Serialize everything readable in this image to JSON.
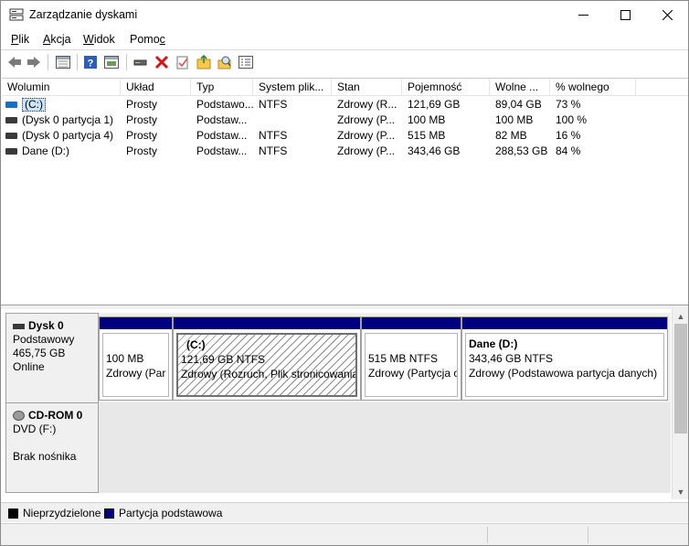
{
  "window": {
    "title": "Zarządzanie dyskami"
  },
  "menu": [
    {
      "pre": "",
      "ul": "P",
      "post": "lik"
    },
    {
      "pre": "",
      "ul": "A",
      "post": "kcja"
    },
    {
      "pre": "",
      "ul": "W",
      "post": "idok"
    },
    {
      "pre": "Pomo",
      "ul": "c",
      "post": ""
    }
  ],
  "toolbar": {
    "icons": [
      "back-arrow-icon",
      "forward-arrow-icon",
      "properties-grid-icon",
      "help-icon",
      "show-hide-pane-icon",
      "connect-drive-icon",
      "delete-icon",
      "checklist-icon",
      "new-folder-icon",
      "search-icon",
      "properties-list-icon"
    ]
  },
  "columns": [
    "Wolumin",
    "Układ",
    "Typ",
    "System plik...",
    "Stan",
    "Pojemność",
    "Wolne ...",
    "% wolnego"
  ],
  "volumes": [
    {
      "name": "(C:)",
      "layout": "Prosty",
      "type": "Podstawo...",
      "fs": "NTFS",
      "status": "Zdrowy (R...",
      "capacity": "121,69 GB",
      "free": "89,04 GB",
      "pct": "73 %"
    },
    {
      "name": "(Dysk 0 partycja 1)",
      "layout": "Prosty",
      "type": "Podstaw...",
      "fs": "",
      "status": "Zdrowy (P...",
      "capacity": "100 MB",
      "free": "100 MB",
      "pct": "100 %"
    },
    {
      "name": "(Dysk 0 partycja 4)",
      "layout": "Prosty",
      "type": "Podstaw...",
      "fs": "NTFS",
      "status": "Zdrowy (P...",
      "capacity": "515 MB",
      "free": "82 MB",
      "pct": "16 %"
    },
    {
      "name": "Dane (D:)",
      "layout": "Prosty",
      "type": "Podstaw...",
      "fs": "NTFS",
      "status": "Zdrowy (P...",
      "capacity": "343,46 GB",
      "free": "288,53 GB",
      "pct": "84 %"
    }
  ],
  "disk0": {
    "name": "Dysk 0",
    "type": "Podstawowy",
    "size": "465,75 GB",
    "state": "Online",
    "partitions": [
      {
        "name": "",
        "size": "100 MB",
        "status": "Zdrowy (Par"
      },
      {
        "name": "(C:)",
        "size": "121,69 GB NTFS",
        "status": "Zdrowy (Rozruch, Plik stronicowania"
      },
      {
        "name": "",
        "size": "515 MB NTFS",
        "status": "Zdrowy (Partycja o"
      },
      {
        "name": "Dane  (D:)",
        "size": "343,46 GB NTFS",
        "status": "Zdrowy (Podstawowa partycja danych)"
      }
    ]
  },
  "cdrom0": {
    "name": "CD-ROM 0",
    "type": "DVD (F:)",
    "state": "Brak nośnika"
  },
  "legend": {
    "unallocated": "Nieprzydzielone",
    "primary": "Partycja podstawowa"
  },
  "colors": {
    "partition_bar": "#000080",
    "selection": "#cce4f7"
  }
}
